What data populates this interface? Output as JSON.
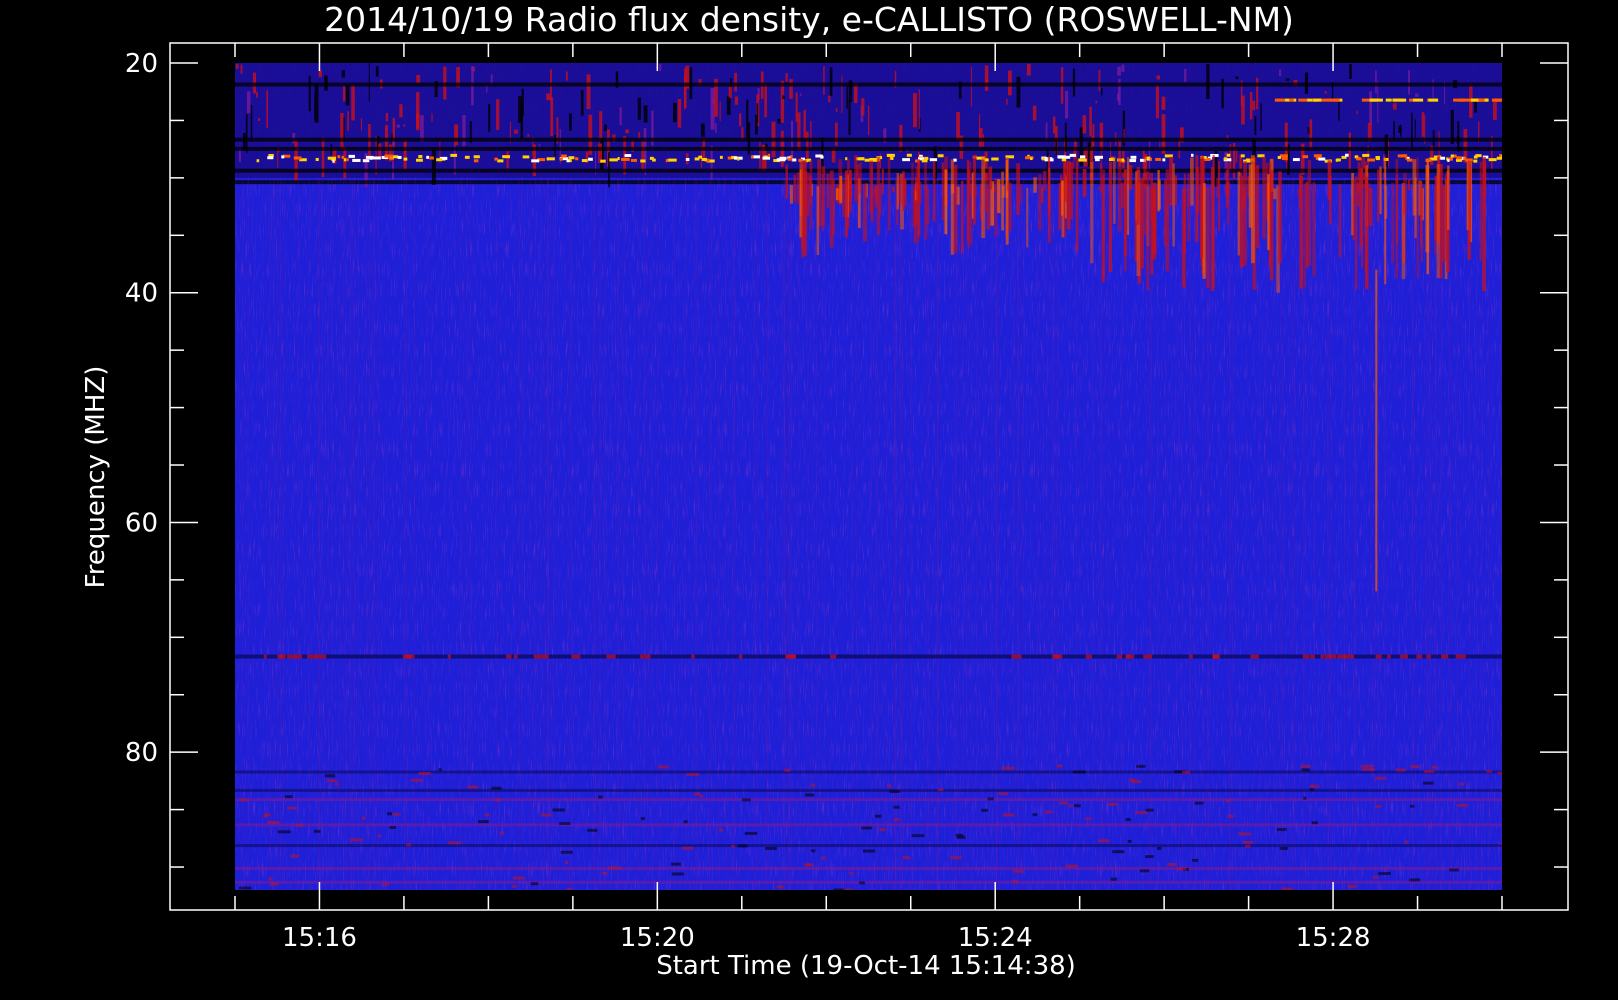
{
  "chart_data": {
    "type": "heatmap",
    "title": "2014/10/19  Radio flux density, e-CALLISTO (ROSWELL-NM)",
    "xlabel": "Start Time (19-Oct-14 15:14:38)",
    "ylabel": "Frequency (MHZ)",
    "x_range": [
      "15:15:00",
      "15:30:00"
    ],
    "y_range": [
      20,
      92
    ],
    "y_inverted": true,
    "x_ticks": [
      "15:16",
      "15:20",
      "15:24",
      "15:28"
    ],
    "x_tick_values_min": [
      16,
      20,
      24,
      28
    ],
    "y_ticks": [
      20,
      40,
      60,
      80
    ],
    "colormap": [
      "#000000",
      "#1a0a8c",
      "#1f1fd8",
      "#7a1a9a",
      "#c8101a",
      "#ff5a00",
      "#ffd200",
      "#ffffff"
    ],
    "background_color": "#1f1fd8",
    "features": [
      {
        "desc": "interference band",
        "freq_mhz": [
          20,
          30
        ],
        "time": [
          "15:15",
          "15:30"
        ]
      },
      {
        "desc": "bright line",
        "freq_mhz": 28,
        "time": [
          "15:15",
          "15:30"
        ]
      },
      {
        "desc": "bright line",
        "freq_mhz": 23,
        "time": [
          "15:27",
          "15:30"
        ]
      },
      {
        "desc": "burst vertical streaks",
        "freq_mhz": [
          20,
          40
        ],
        "time": [
          "15:22",
          "15:30"
        ]
      },
      {
        "desc": "weak horizontal line",
        "freq_mhz": 71.5,
        "time": [
          "15:15",
          "15:30"
        ]
      },
      {
        "desc": "weak horizontal lines",
        "freq_mhz": [
          82,
          91
        ],
        "time": [
          "15:15",
          "15:30"
        ]
      }
    ],
    "grid": false,
    "legend": "none"
  }
}
